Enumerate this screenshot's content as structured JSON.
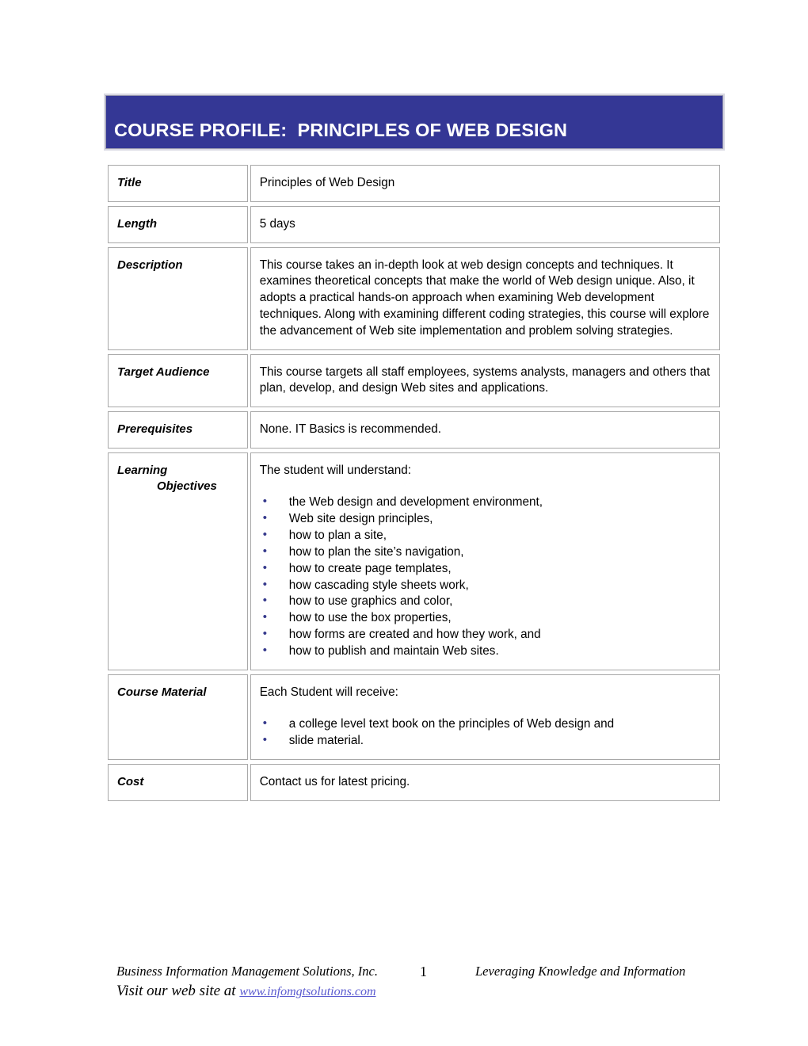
{
  "document": {
    "banner_title": "COURSE PROFILE:  PRINCIPLES OF WEB DESIGN",
    "accent_color": "#343795",
    "link_color": "#5b5bd0",
    "bullet_color": "#363a8c"
  },
  "table": {
    "rows": [
      {
        "label": "Title",
        "label_line2": "",
        "paragraphs": [
          "Principles of Web Design"
        ],
        "bullets": []
      },
      {
        "label": "Length",
        "label_line2": "",
        "paragraphs": [
          "5 days"
        ],
        "bullets": []
      },
      {
        "label": "Description",
        "label_line2": "",
        "paragraphs": [
          "This course takes an in-depth look at web design concepts and techniques.  It examines theoretical concepts that make the world of Web design unique.  Also, it adopts a practical hands-on approach when examining Web development techniques.  Along with examining different coding strategies, this course will explore the advancement of Web site implementation and problem solving strategies."
        ],
        "bullets": []
      },
      {
        "label": "Target Audience",
        "label_line2": "",
        "paragraphs": [
          "This course targets all staff employees, systems analysts, managers and others that plan, develop, and design Web sites and applications."
        ],
        "bullets": []
      },
      {
        "label": "Prerequisites",
        "label_line2": "",
        "paragraphs": [
          "None.  IT Basics is recommended."
        ],
        "bullets": []
      },
      {
        "label": "Learning",
        "label_line2": "Objectives",
        "paragraphs": [
          "The student will understand:"
        ],
        "bullets": [
          "the Web design and development environment,",
          "Web site design principles,",
          "how to plan a site,",
          "how to plan the site’s navigation,",
          "how to create page templates,",
          "how cascading style sheets work,",
          "how to use graphics and color,",
          "how to use the box properties,",
          "how forms are created and how they work, and",
          "how to publish and maintain Web sites."
        ]
      },
      {
        "label": "Course Material",
        "label_line2": "",
        "paragraphs": [
          "Each Student will receive:"
        ],
        "bullets": [
          "a college level text book on the principles of Web design and",
          "slide material."
        ]
      },
      {
        "label": "Cost",
        "label_line2": "",
        "paragraphs": [
          "Contact us for latest pricing."
        ],
        "bullets": []
      }
    ]
  },
  "footer": {
    "company": "Business Information Management Solutions, Inc.",
    "page_number": "1",
    "tagline": "Leveraging Knowledge and Information",
    "visit_prefix": "Visit our web site at ",
    "website": "www.infomgtsolutions.com"
  }
}
